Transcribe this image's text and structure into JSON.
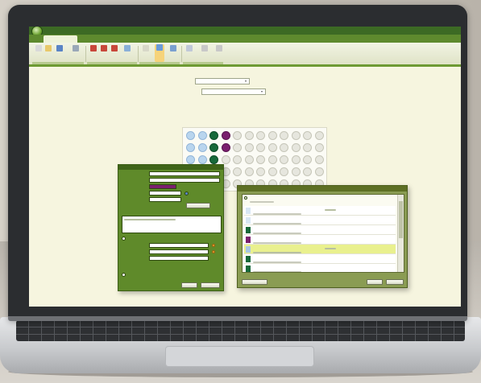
{
  "window": {
    "title": "",
    "tabs": [
      {
        "label": "",
        "active": true
      },
      {
        "label": "",
        "active": false
      },
      {
        "label": "",
        "active": false
      }
    ]
  },
  "ribbon": {
    "buttons": [
      {
        "label": "",
        "icon": "new-icon",
        "color": "#d9d9d9"
      },
      {
        "label": "",
        "icon": "open-icon",
        "color": "#e8c86a"
      },
      {
        "label": "",
        "icon": "save-icon",
        "color": "#5a84c6"
      },
      {
        "label": "",
        "icon": "print-icon",
        "color": "#9aa8b8"
      },
      {
        "label": "",
        "icon": "add-icon",
        "color": "#c8473a"
      },
      {
        "label": "",
        "icon": "edit-icon",
        "color": "#c8473a"
      },
      {
        "label": "",
        "icon": "delete-icon",
        "color": "#c8473a"
      },
      {
        "label": "",
        "icon": "import-icon",
        "color": "#8ab0d8"
      },
      {
        "label": "",
        "icon": "layout-icon",
        "color": "#d8d8c8"
      },
      {
        "label": "",
        "icon": "active-view-icon",
        "color": "#6a9ad8"
      },
      {
        "label": "",
        "icon": "view-icon",
        "color": "#7aa0d0"
      },
      {
        "label": "",
        "icon": "chart-icon",
        "color": "#c0c8d8"
      },
      {
        "label": "",
        "icon": "settings-icon",
        "color": "#c8c8c8"
      },
      {
        "label": "",
        "icon": "search-icon",
        "color": "#c8c8c8"
      }
    ]
  },
  "selectors": {
    "container_type": "",
    "container_label": "",
    "container_value": ""
  },
  "plate": {
    "rows": [
      [
        "b",
        "b",
        "g",
        "p",
        "t",
        "t",
        "t",
        "t",
        "t",
        "t",
        "t",
        "t"
      ],
      [
        "b",
        "b",
        "g",
        "p",
        "t",
        "t",
        "t",
        "t",
        "t",
        "t",
        "t",
        "t"
      ],
      [
        "b",
        "b",
        "g",
        "t",
        "t",
        "t",
        "t",
        "t",
        "t",
        "t",
        "t",
        "t"
      ],
      [
        "t",
        "t",
        "t",
        "t",
        "t",
        "t",
        "t",
        "t",
        "t",
        "t",
        "t",
        "t"
      ],
      [
        "t",
        "t",
        "t",
        "t",
        "t",
        "t",
        "t",
        "t",
        "t",
        "t",
        "t",
        "t"
      ]
    ]
  },
  "sample_dialog": {
    "labels": [
      "",
      "",
      "",
      "",
      "",
      "",
      ""
    ],
    "values": [
      "",
      "",
      "",
      "",
      "",
      ""
    ],
    "colour_field": "#7a1f6e",
    "button_label": "",
    "comment_label": "",
    "comment_text": "",
    "section_a_label": "",
    "section_a_fields": [
      "",
      "",
      ""
    ],
    "section_b_label": "",
    "ok_label": "",
    "cancel_label": ""
  },
  "sample_list_dialog": {
    "title": "",
    "group_label": "",
    "items": [
      {
        "name": "",
        "color": "#d7e6f4",
        "highlight": false,
        "tick": true
      },
      {
        "name": "",
        "color": "#d7e6f4",
        "highlight": false,
        "tick": false
      },
      {
        "name": "",
        "color": "#17693a",
        "highlight": false,
        "tick": false
      },
      {
        "name": "",
        "color": "#7a1f6e",
        "highlight": false,
        "tick": false
      },
      {
        "name": "",
        "color": "#a8c6e4",
        "highlight": true,
        "tick": true
      },
      {
        "name": "",
        "color": "#17693a",
        "highlight": false,
        "tick": false
      },
      {
        "name": "",
        "color": "#17693a",
        "highlight": false,
        "tick": false
      }
    ],
    "left_button": "",
    "ok_label": "",
    "cancel_label": ""
  }
}
